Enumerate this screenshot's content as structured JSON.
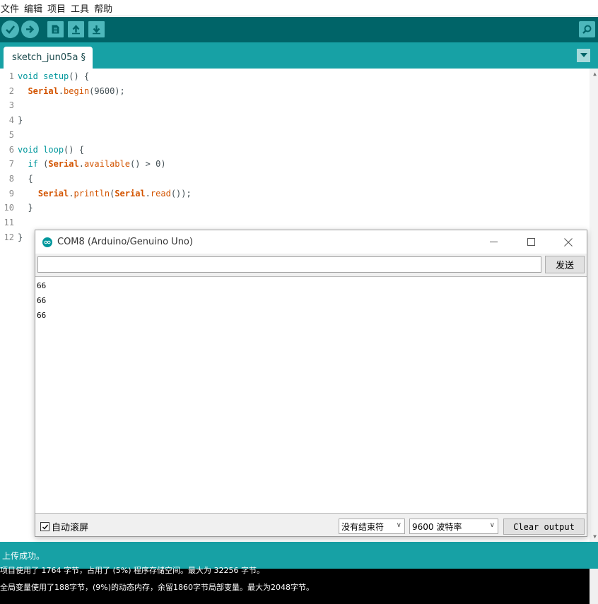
{
  "menu": {
    "items": [
      "文件",
      "编辑",
      "项目",
      "工具",
      "帮助"
    ]
  },
  "toolbar": {
    "buttons": [
      {
        "name": "verify",
        "icon": "check-icon"
      },
      {
        "name": "upload",
        "icon": "arrow-right-icon"
      },
      {
        "name": "new",
        "icon": "new-file-icon"
      },
      {
        "name": "open",
        "icon": "arrow-up-icon"
      },
      {
        "name": "save",
        "icon": "arrow-down-icon"
      }
    ],
    "serial_monitor_icon": "magnifier-icon"
  },
  "tabs": {
    "active_label": "sketch_jun05a §"
  },
  "editor": {
    "line_numbers": [
      "1",
      "2",
      "3",
      "4",
      "5",
      "6",
      "7",
      "8",
      "9",
      "10",
      "11",
      "12"
    ]
  },
  "status": {
    "message": "上传成功。"
  },
  "console": {
    "lines": [
      "项目使用了 1764 字节，占用了 (5%) 程序存储空间。最大为 32256 字节。",
      "全局变量使用了188字节，(9%)的动态内存，余留1860字节局部变量。最大为2048字节。"
    ]
  },
  "serial_monitor": {
    "title": "COM8 (Arduino/Genuino Uno)",
    "input_value": "",
    "send_label": "发送",
    "output_lines": [
      "66",
      "66",
      "66"
    ],
    "autoscroll_label": "自动滚屏",
    "autoscroll_checked": true,
    "line_ending": "没有结束符",
    "baud_rate": "9600 波特率",
    "clear_label": "Clear output"
  },
  "colors": {
    "toolbar": "#006468",
    "tabbar": "#17a1a5",
    "button": "#4db7bb",
    "keyword": "#00979c",
    "function": "#d35400"
  }
}
